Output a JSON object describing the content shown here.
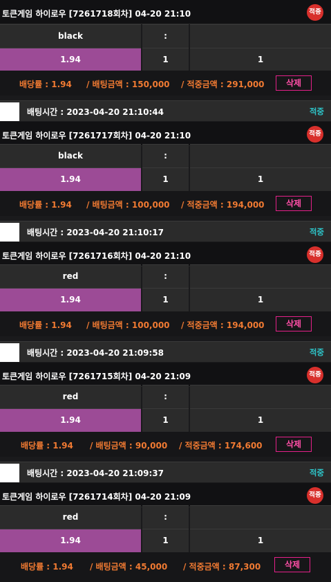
{
  "bets": [
    {
      "bet_time": null,
      "hit_status": null,
      "title": "토큰게임 하이로우  [7261718회차]  04-20 21:10",
      "badge": "적중",
      "pick": "black",
      "sep": ":",
      "odds_cell": "1.94",
      "left_val": "1",
      "right_val": "1",
      "odds_text": "배당률 : 1.94",
      "amount_text": "/ 배팅금액 : 150,000",
      "win_text": "/ 적중금액 : 291,000",
      "delete_label": "삭제"
    },
    {
      "bet_time": "배팅시간 : 2023-04-20 21:10:44",
      "hit_status": "적중",
      "title": "토큰게임 하이로우  [7261717회차]  04-20 21:10",
      "badge": "적중",
      "pick": "black",
      "sep": ":",
      "odds_cell": "1.94",
      "left_val": "1",
      "right_val": "1",
      "odds_text": "배당률 : 1.94",
      "amount_text": "/ 배팅금액 : 100,000",
      "win_text": "/ 적중금액 : 194,000",
      "delete_label": "삭제"
    },
    {
      "bet_time": "배팅시간 : 2023-04-20 21:10:17",
      "hit_status": "적중",
      "title": "토큰게임 하이로우  [7261716회차]  04-20 21:10",
      "badge": "적중",
      "pick": "red",
      "sep": ":",
      "odds_cell": "1.94",
      "left_val": "1",
      "right_val": "1",
      "odds_text": "배당률 : 1.94",
      "amount_text": "/ 배팅금액 : 100,000",
      "win_text": "/ 적중금액 : 194,000",
      "delete_label": "삭제"
    },
    {
      "bet_time": "배팅시간 : 2023-04-20 21:09:58",
      "hit_status": "적중",
      "title": "토큰게임 하이로우  [7261715회차]  04-20 21:09",
      "badge": "적중",
      "pick": "red",
      "sep": ":",
      "odds_cell": "1.94",
      "left_val": "1",
      "right_val": "1",
      "odds_text": "배당률 : 1.94",
      "amount_text": "/ 배팅금액 : 90,000",
      "win_text": "/ 적중금액 : 174,600",
      "delete_label": "삭제"
    },
    {
      "bet_time": "배팅시간 : 2023-04-20 21:09:37",
      "hit_status": "적중",
      "title": "토큰게임 하이로우  [7261714회차]  04-20 21:09",
      "badge": "적중",
      "pick": "red",
      "sep": ":",
      "odds_cell": "1.94",
      "left_val": "1",
      "right_val": "1",
      "odds_text": "배당률 : 1.94",
      "amount_text": "/ 배팅금액 : 45,000",
      "win_text": "/ 적중금액 : 87,300",
      "delete_label": "삭제"
    }
  ],
  "colors": {
    "highlight": "#9c4b96",
    "badge": "#d8302c",
    "info_text": "#f07a32",
    "hit_text": "#2ec4c8",
    "delete_border": "#e6208a"
  }
}
